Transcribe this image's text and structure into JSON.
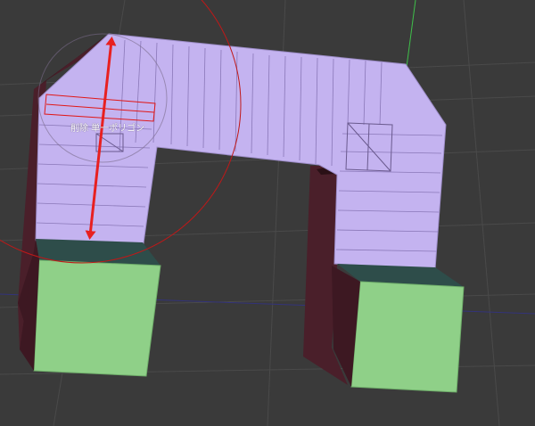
{
  "viewport": {
    "tool_label": "削除 単一ポリゴン",
    "colors": {
      "background": "#3a3a3a",
      "grid_line": "#4a4a4a",
      "axis_green": "#3fbf4a",
      "axis_blue": "#33337a",
      "arch_face": "#c4b3f0",
      "arch_side": "#4a1f2a",
      "block_face": "#8fd088",
      "block_top": "#2e4d4a",
      "selection_red": "#e01818",
      "arrow_red": "#e82020"
    },
    "icons": {
      "brush_cursor": "circle-cursor-icon",
      "measure_arrow": "double-arrow-icon"
    }
  }
}
